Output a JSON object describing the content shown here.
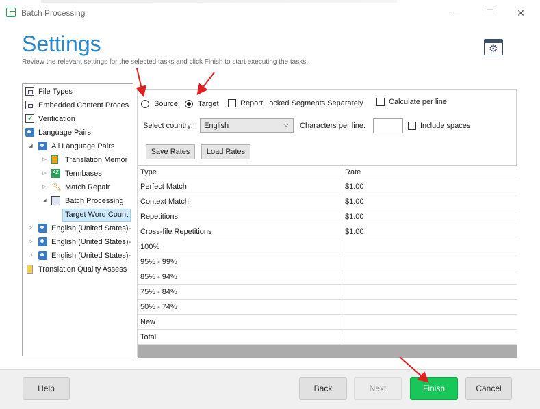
{
  "window": {
    "title": "Batch Processing",
    "minimize_icon": "—",
    "maximize_icon": "☐",
    "close_icon": "✕"
  },
  "header": {
    "title": "Settings",
    "subtitle": "Review the relevant settings for the selected tasks and click Finish to start executing the tasks."
  },
  "tree": {
    "items": [
      {
        "label": "File Types"
      },
      {
        "label": "Embedded Content Proces"
      },
      {
        "label": "Verification"
      },
      {
        "label": "Language Pairs"
      },
      {
        "label": "All Language Pairs"
      },
      {
        "label": "Translation Memor"
      },
      {
        "label": "Termbases"
      },
      {
        "label": "Match Repair"
      },
      {
        "label": "Batch Processing"
      },
      {
        "label": "Target Word Count"
      },
      {
        "label": "English (United States)-"
      },
      {
        "label": "English (United States)-"
      },
      {
        "label": "English (United States)-"
      },
      {
        "label": "Translation Quality Assess"
      }
    ]
  },
  "options": {
    "source_label": "Source",
    "target_label": "Target",
    "selected": "Target",
    "report_locked_label": "Report Locked Segments Separately",
    "report_locked_checked": false,
    "calc_per_line_label": "Calculate per line",
    "calc_per_line_checked": false,
    "country_label": "Select country:",
    "country_value": "English",
    "chars_per_line_label": "Characters per line:",
    "chars_per_line_value": "",
    "include_spaces_label": "Include spaces",
    "include_spaces_checked": false,
    "save_rates_label": "Save Rates",
    "load_rates_label": "Load Rates"
  },
  "rates_table": {
    "headers": [
      "Type",
      "Rate"
    ],
    "rows": [
      [
        "Perfect Match",
        "$1.00"
      ],
      [
        "Context Match",
        "$1.00"
      ],
      [
        "Repetitions",
        "$1.00"
      ],
      [
        "Cross-file Repetitions",
        "$1.00"
      ],
      [
        "100%",
        ""
      ],
      [
        "95% - 99%",
        ""
      ],
      [
        "85% - 94%",
        ""
      ],
      [
        "75% - 84%",
        ""
      ],
      [
        "50% - 74%",
        ""
      ],
      [
        "New",
        ""
      ],
      [
        "Total",
        ""
      ]
    ]
  },
  "footer": {
    "help_label": "Help",
    "back_label": "Back",
    "next_label": "Next",
    "finish_label": "Finish",
    "cancel_label": "Cancel"
  },
  "colors": {
    "accent": "#2b86c9",
    "finish_green": "#17c75a",
    "annotation_red": "#e02020",
    "selected_bg": "#cce8ff"
  }
}
